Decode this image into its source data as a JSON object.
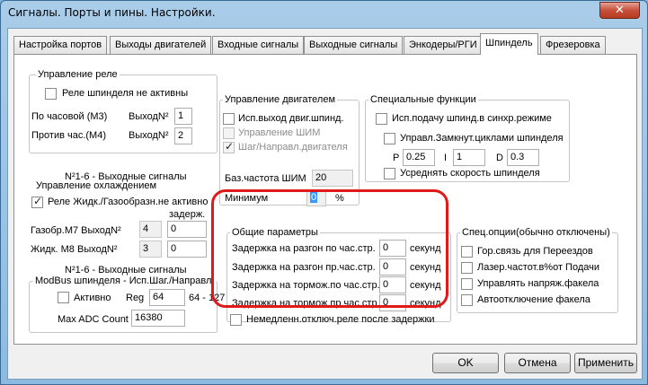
{
  "window": {
    "title": "Сигналы. Порты и пины. Настройки.",
    "close": "✕"
  },
  "tabs": [
    "Настройка портов",
    "Выходы двигателей",
    "Входные сигналы",
    "Выходные сигналы",
    "Энкодеры/РГИ",
    "Шпиндель",
    "Фрезеровка"
  ],
  "relay": {
    "title": "Управление реле",
    "inactive": "Реле шпинделя не активны",
    "cw": "По часовой (M3)",
    "ccw": "Против час.(M4)",
    "output_lbl": "ВыходN²",
    "cw_val": "1",
    "ccw_val": "2",
    "note": "N²1-6 - Выходные сигналы"
  },
  "cooling": {
    "title": "Управление охлаждением",
    "inactive": "Реле Жидк./Газообразн.не активно",
    "delay": "задерж.",
    "gas": "Газобр.M7 ВыходN²",
    "liquid": "Жидк. M8 ВыходN²",
    "gas_val": "4",
    "liquid_val": "3",
    "gas_delay": "0",
    "liquid_delay": "0",
    "note": "N²1-6 - Выходные сигналы"
  },
  "modbus": {
    "title": "ModBus шпинделя - Исп.Шаг./Направл.",
    "active": "Активно",
    "reg": "Reg",
    "reg_val": "64",
    "range": "64 - 127",
    "max_adc": "Max ADC Count",
    "max_adc_val": "16380"
  },
  "motor": {
    "title": "Управление двигателем",
    "use_out": "Исп.выход двиг.шпинд.",
    "pwm": "Управление ШИМ",
    "step": "Шаг/Направл.двигателя",
    "base_freq": "Баз.частота ШИМ",
    "base_freq_val": "20",
    "min": "Минимум",
    "min_val": "0",
    "percent": "%"
  },
  "special": {
    "title": "Специальные функции",
    "sync": "Исп.подачу шпинд.в синхр.режиме",
    "closed_loop": "Управл.Замкнут.циклами шпинделя",
    "p": "P",
    "p_val": "0.25",
    "i": "I",
    "i_val": "1",
    "d": "D",
    "d_val": "0.3",
    "avg": "Усреднять скорость шпинделя"
  },
  "general": {
    "title": "Общие параметры",
    "rows": [
      {
        "label": "Задержка на разгон по час.стр.",
        "value": "0",
        "unit": "секунд"
      },
      {
        "label": "Задержка на разгон пр.час.стр.",
        "value": "0",
        "unit": "секунд"
      },
      {
        "label": "Задержка на тормож.по час.стр.",
        "value": "0",
        "unit": "секунд"
      },
      {
        "label": "Задержка на тормож.пр.час.стр.",
        "value": "0",
        "unit": "секунд"
      }
    ],
    "immediate": "Немедленн.отключ.реле после задержки"
  },
  "options": {
    "title": "Спец.опции(обычно отключены)",
    "items": [
      "Гор.связь для Переездов",
      "Лазер.частот.в%от Подачи",
      "Управлять напряж.факела",
      "Автоотключение факела"
    ]
  },
  "buttons": {
    "ok": "OK",
    "cancel": "Отмена",
    "apply": "Применить"
  },
  "colors": {
    "highlight": "#e01919",
    "selection": "#3399ff"
  }
}
